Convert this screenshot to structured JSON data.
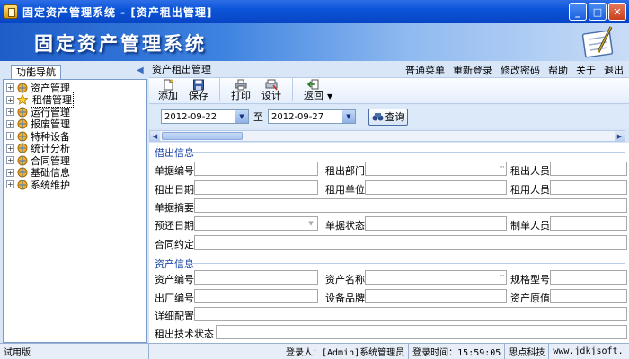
{
  "window": {
    "title": "固定资产管理系统 - [资产租出管理]",
    "buttons": {
      "minimize": "_",
      "maximize": "□",
      "close": "✕"
    }
  },
  "banner": {
    "title": "固定资产管理系统"
  },
  "sidebar": {
    "tab_label": "功能导航",
    "items": [
      {
        "label": "资产管理",
        "expander": "+"
      },
      {
        "label": "租借管理",
        "expander": "+",
        "selected": true
      },
      {
        "label": "运行管理",
        "expander": "+"
      },
      {
        "label": "报废管理",
        "expander": "+"
      },
      {
        "label": "特种设备",
        "expander": "+"
      },
      {
        "label": "统计分析",
        "expander": "+"
      },
      {
        "label": "合同管理",
        "expander": "+"
      },
      {
        "label": "基础信息",
        "expander": "+"
      },
      {
        "label": "系统维护",
        "expander": "+"
      }
    ]
  },
  "page": {
    "title": "资产租出管理"
  },
  "top_menu": [
    "普通菜单",
    "重新登录",
    "修改密码",
    "帮助",
    "关于",
    "退出"
  ],
  "toolbar": {
    "add": "添加",
    "save": "保存",
    "print": "打印",
    "design": "设计",
    "back": "返回"
  },
  "filter": {
    "start_date": "2012-09-22",
    "to": "至",
    "end_date": "2012-09-27",
    "query": "查询"
  },
  "lend_info": {
    "title": "借出信息",
    "doc_no": "单据编号",
    "rent_dept": "租出部门",
    "rent_person": "租出人员",
    "rent_date": "租出日期",
    "renting_unit": "租用单位",
    "renting_person": "租用人员",
    "doc_summary": "单据摘要",
    "expected_return": "预还日期",
    "doc_status": "单据状态",
    "creator": "制单人员",
    "contract": "合同约定"
  },
  "asset_info": {
    "title": "资产信息",
    "asset_no": "资产编号",
    "asset_name": "资产名称",
    "spec_model": "规格型号",
    "factory_no": "出厂编号",
    "brand": "设备品牌",
    "original_value": "资产原值",
    "detail_config": "详细配置",
    "tech_status": "租出技术状态"
  },
  "status": {
    "version": "试用版",
    "login_user": "登录人：[Admin]系统管理员",
    "login_time": "登录时间：15:59:05",
    "company": "思点科技",
    "website": "www.jdkjsoft."
  }
}
